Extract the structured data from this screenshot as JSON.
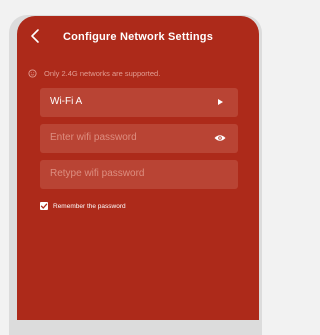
{
  "header": {
    "title": "Configure Network Settings",
    "back_icon": "chevron-left-icon"
  },
  "notice": {
    "icon": "info-circle-icon",
    "text": "Only 2.4G networks are supported."
  },
  "wifi_select": {
    "value": "Wi-Fi A",
    "icon": "play-triangle-icon"
  },
  "password": {
    "placeholder": "Enter wifi password",
    "icon": "eye-icon"
  },
  "retype_password": {
    "placeholder": "Retype wifi password"
  },
  "remember": {
    "label": "Remember the password",
    "checked": true
  },
  "colors": {
    "background": "#ad2a1a",
    "field": "#b94434",
    "placeholder": "#dd8e80",
    "text": "#ffffff"
  }
}
